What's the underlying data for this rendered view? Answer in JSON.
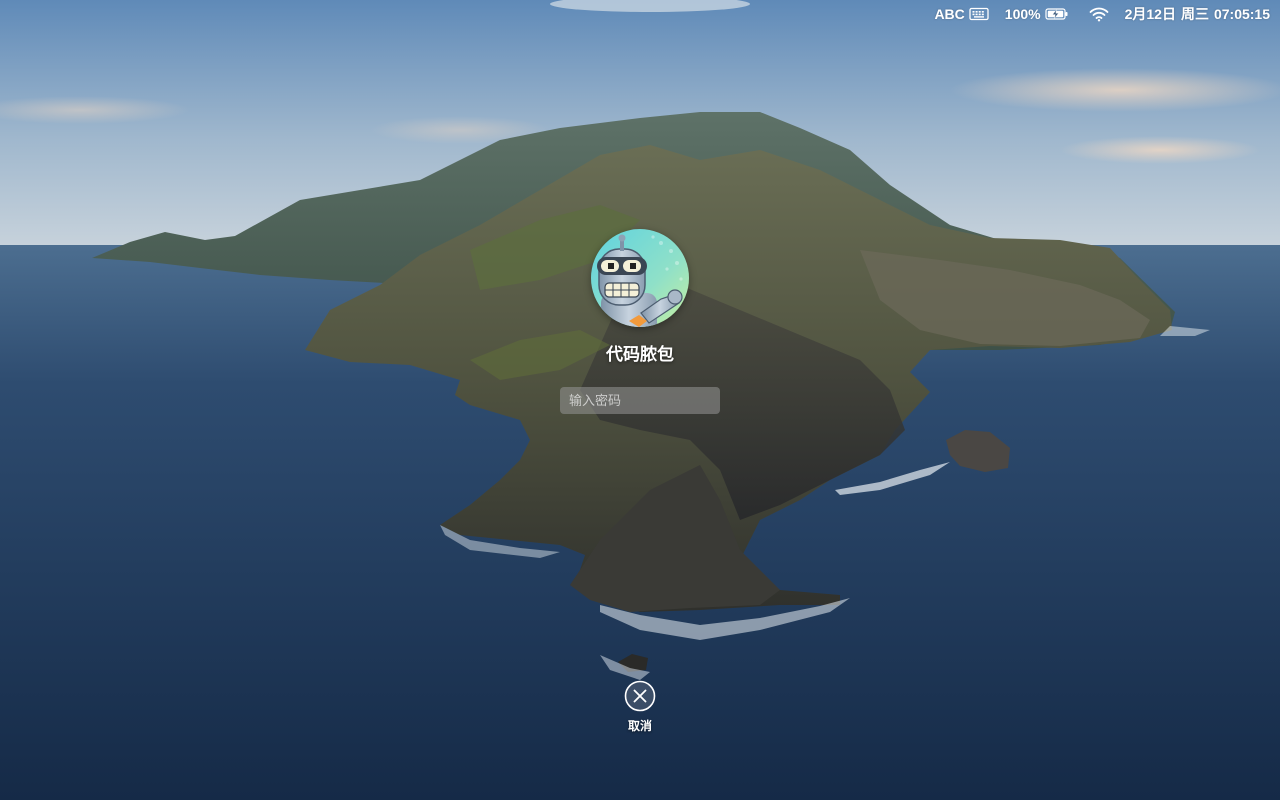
{
  "menubar": {
    "input_source": "ABC",
    "battery_percent": "100%",
    "date": "2月12日",
    "weekday": "周三",
    "time": "07:05:15",
    "icons": [
      "keyboard-icon",
      "battery-charging-icon",
      "wifi-icon"
    ]
  },
  "login": {
    "user_name": "代码脓包",
    "password_placeholder": "输入密码",
    "password_value": "",
    "cancel_label": "取消",
    "avatar_icon": "robot-avatar-icon",
    "cancel_icon": "close-circle-icon"
  },
  "colors": {
    "sky_top": "#5f8ab8",
    "sea": "#1f3a5c",
    "island": "#4a5040",
    "menubar_text": "#ffffff"
  }
}
